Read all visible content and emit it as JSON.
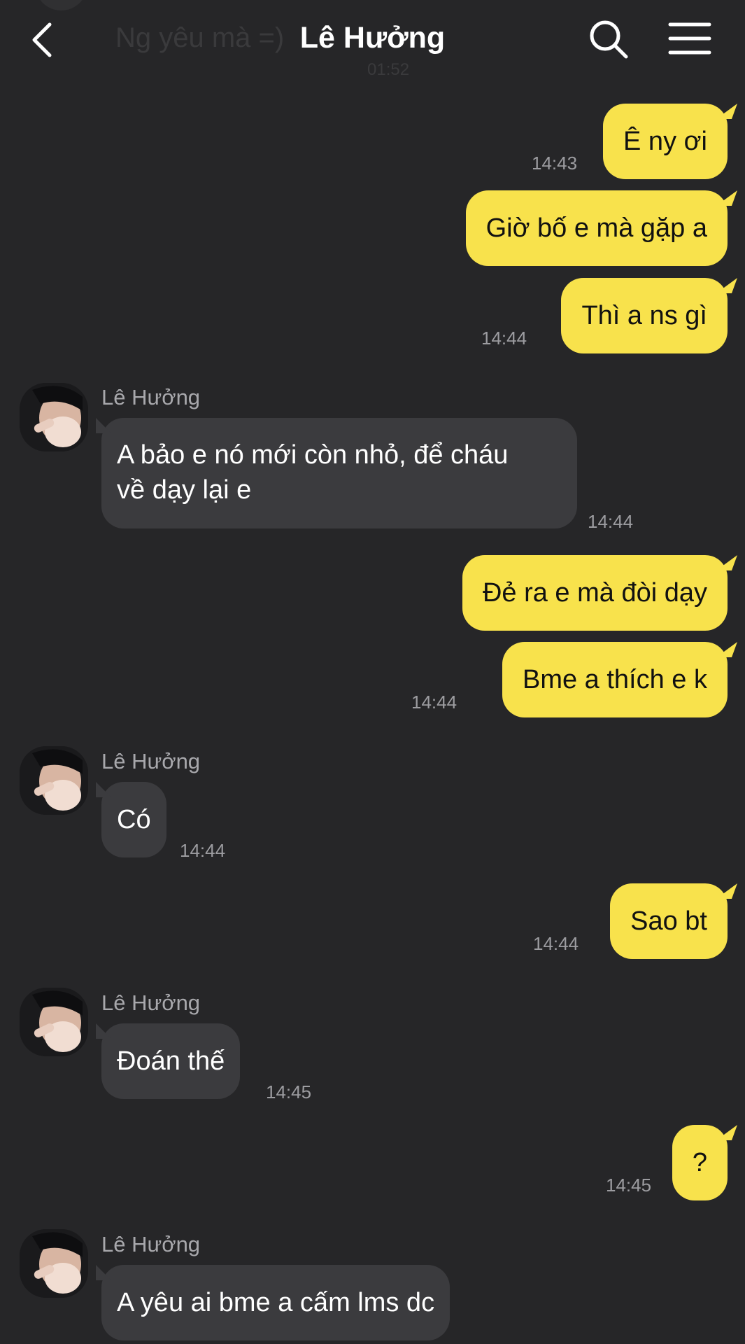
{
  "header": {
    "title": "Lê Hưởng",
    "ghost_preview_text": "Ng yêu mà =)",
    "ghost_preview_time": "01:52"
  },
  "messages": [
    {
      "side": "out",
      "text": "Ê ny ơi",
      "time": "14:43"
    },
    {
      "side": "out",
      "text": "Giờ bố e mà gặp a",
      "time": ""
    },
    {
      "side": "out",
      "text": "Thì a ns gì",
      "time": "14:44"
    },
    {
      "side": "in",
      "sender": "Lê Hưởng",
      "lines": [
        "A bảo e nó mới còn nhỏ, để cháu",
        "về dạy lại e"
      ],
      "time": "14:44"
    },
    {
      "side": "out",
      "text": "Đẻ ra e mà đòi dạy",
      "time": ""
    },
    {
      "side": "out",
      "text": "Bme a thích e k",
      "time": "14:44"
    },
    {
      "side": "in",
      "sender": "Lê Hưởng",
      "lines": [
        "Có"
      ],
      "time": "14:44"
    },
    {
      "side": "out",
      "text": "Sao bt",
      "time": "14:44"
    },
    {
      "side": "in",
      "sender": "Lê Hưởng",
      "lines": [
        "Đoán thế"
      ],
      "time": "14:45"
    },
    {
      "side": "out",
      "text": "?",
      "time": "14:45"
    },
    {
      "side": "in",
      "sender": "Lê Hưởng",
      "lines": [
        "A yêu ai bme a cấm lms dc"
      ],
      "time": ""
    }
  ],
  "colors": {
    "background": "#262628",
    "outgoing_bubble": "#f8e24c",
    "incoming_bubble": "#3b3b3e",
    "timestamp": "#9c9ca0"
  },
  "icons": {
    "back": "chevron-left-icon",
    "search": "search-icon",
    "menu": "menu-icon",
    "avatar": "avatar"
  }
}
